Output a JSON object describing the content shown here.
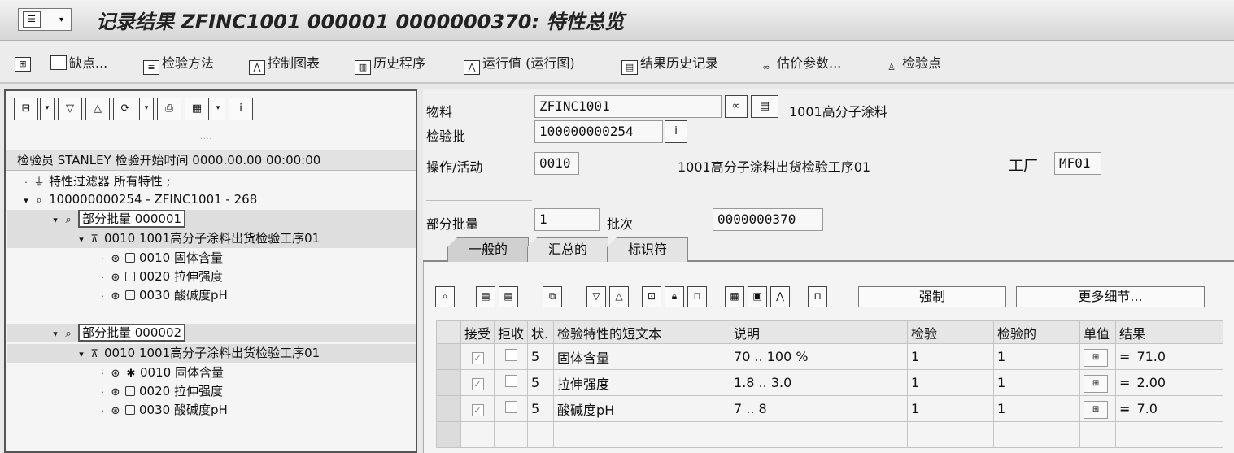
{
  "window": {
    "title": "记录结果 ZFINC1001 000001 0000000370: 特性总览"
  },
  "toolbar": [
    {
      "label": "缺点...",
      "icon": "doc-icon"
    },
    {
      "label": "检验方法",
      "icon": "method-icon"
    },
    {
      "label": "控制图表",
      "icon": "chart-icon"
    },
    {
      "label": "历史程序",
      "icon": "history-icon"
    },
    {
      "label": "运行值 (运行图)",
      "icon": "run-chart-icon"
    },
    {
      "label": "结果历史记录",
      "icon": "result-history-icon"
    },
    {
      "label": "估价参数...",
      "icon": "glasses-icon"
    },
    {
      "label": "检验点",
      "icon": "inspection-point-icon"
    }
  ],
  "left": {
    "dots": ".....",
    "header": "检验员 STANLEY 检验开始时间 0000.00.00 00:00:00",
    "tree": [
      {
        "text": "特性过滤器 所有特性 ;"
      },
      {
        "text": "100000000254 - ZFINC1001 - 268"
      },
      {
        "text": "部分批量 000001"
      },
      {
        "text": "0010 1001高分子涂料出货检验工序01"
      },
      {
        "text": "0010 固体含量"
      },
      {
        "text": "0020 拉伸强度"
      },
      {
        "text": "0030 酸碱度pH"
      },
      {
        "text": "部分批量 000002"
      },
      {
        "text": "0010 1001高分子涂料出货检验工序01"
      },
      {
        "text": "0010 固体含量"
      },
      {
        "text": "0020 拉伸强度"
      },
      {
        "text": "0030 酸碱度pH"
      }
    ]
  },
  "header_fields": {
    "material_label": "物料",
    "material_value": "ZFINC1001",
    "material_desc": "1001高分子涂料",
    "lot_label": "检验批",
    "lot_value": "100000000254",
    "op_label": "操作/活动",
    "op_value": "0010",
    "op_desc": "1001高分子涂料出货检验工序01",
    "plant_label": "工厂",
    "plant_value": "MF01",
    "partial_label": "部分批量",
    "partial_value": "1",
    "batch_label": "批次",
    "batch_value": "0000000370"
  },
  "tabs": [
    "一般的",
    "汇总的",
    "标识符"
  ],
  "grid_buttons": {
    "force": "强制",
    "more": "更多细节..."
  },
  "table": {
    "columns": [
      "接受",
      "拒收",
      "状.",
      "检验特性的短文本",
      "说明",
      "检验",
      "检验的",
      "单值",
      "结果"
    ],
    "rows": [
      {
        "status": "5",
        "text": "固体含量",
        "desc": "70 .. 100 %",
        "insp": "1",
        "inspected": "1",
        "result": "71.0"
      },
      {
        "status": "5",
        "text": "拉伸强度",
        "desc": "1.8 .. 3.0",
        "insp": "1",
        "inspected": "1",
        "result": "2.00"
      },
      {
        "status": "5",
        "text": "酸碱度pH",
        "desc": "7 .. 8",
        "insp": "1",
        "inspected": "1",
        "result": "7.0"
      }
    ]
  }
}
